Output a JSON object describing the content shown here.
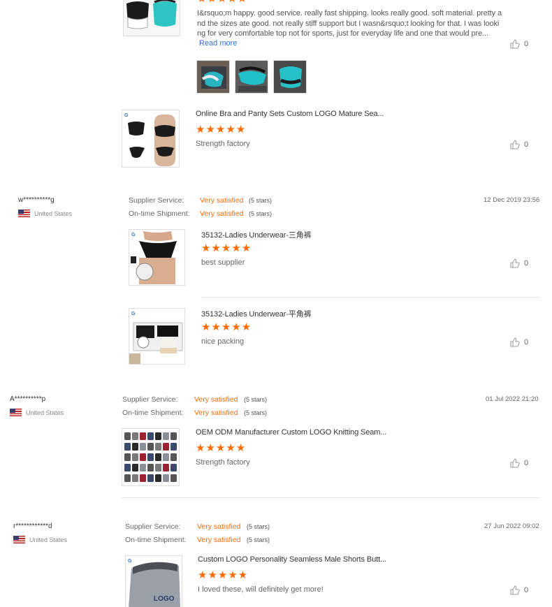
{
  "review0": {
    "text_lines": [
      "I&rsquo;m happy. good service. really fast shipping. looks really good. soft material. pretty a",
      "nd the sizes ate good. not really stiff support but I wasn&rsquo;t looking for that. I was looki",
      "ng for very comfortable top not for sports, just for everyday life and one that would pre..."
    ],
    "read_more": "Read more",
    "likes": "0",
    "stars": "★★★★★",
    "product": {
      "title": "Online Bra and Panty Sets Custom LOGO Mature Sea...",
      "stars": "★★★★★",
      "comment": "Strength factory",
      "likes": "0"
    }
  },
  "reviews": [
    {
      "user": "w**********g",
      "country": "United States",
      "service_label": "Supplier Service:",
      "service_value": "Very satisfied",
      "service_stars": "(5 stars)",
      "shipment_label": "On-time Shipment:",
      "shipment_value": "Very satisfied",
      "shipment_stars": "(5 stars)",
      "date": "12 Dec 2019 23:56",
      "items": [
        {
          "title": "35132-Ladies Underwear-三角裤",
          "stars": "★★★★★",
          "comment": "best supplier",
          "likes": "0"
        },
        {
          "title": "35132-Ladies Underwear-平角裤",
          "stars": "★★★★★",
          "comment": "nice packing",
          "likes": "0"
        }
      ]
    },
    {
      "user": "A**********p",
      "country": "United States",
      "service_label": "Supplier Service:",
      "service_value": "Very satisfied",
      "service_stars": "(5 stars)",
      "shipment_label": "On-time Shipment:",
      "shipment_value": "Very satisfied",
      "shipment_stars": "(5 stars)",
      "date": "01 Jul 2022 21:20",
      "items": [
        {
          "title": "OEM ODM Manufacturer Custom LOGO Knitting Seam...",
          "stars": "★★★★★",
          "comment": "Strength factory",
          "likes": "0"
        }
      ]
    },
    {
      "user": "r************d",
      "country": "United States",
      "service_label": "Supplier Service:",
      "service_value": "Very satisfied",
      "service_stars": "(5 stars)",
      "shipment_label": "On-time Shipment:",
      "shipment_value": "Very satisfied",
      "shipment_stars": "(5 stars)",
      "date": "27 Jun 2022 09:02",
      "items": [
        {
          "title": "Custom LOGO Personality Seamless Male Shorts Butt...",
          "stars": "★★★★★",
          "comment": "I loved these, will definitely get more!",
          "likes": "0",
          "image_text": "LOGO"
        }
      ]
    }
  ],
  "colors": {
    "accent": "#ff6a00",
    "link": "#2f6fd6",
    "divider": "#e5e5e5"
  },
  "icons": {
    "like": "thumbs-up-icon",
    "flag": "us-flag-icon",
    "star": "star-icon"
  }
}
